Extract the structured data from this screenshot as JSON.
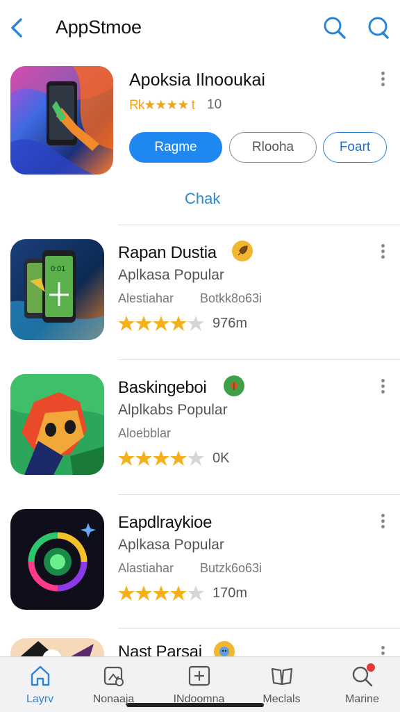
{
  "header": {
    "title": "AppStmoe",
    "back_icon": "chevron-left-icon",
    "search_icon": "search-icon",
    "search2_icon": "search-bubble-icon",
    "accent": "#1e88f0"
  },
  "featured": {
    "title": "Apoksia Ilnooukai",
    "rating_text": "Rk★★★★ t",
    "rating_count": "10",
    "btn_primary": "Ragme",
    "btn_outline": "Rlooha",
    "btn_blue": "Foart",
    "link": "Chak"
  },
  "list": [
    {
      "title": "Rapan Dustia",
      "subtitle": "Aplkasa Popular",
      "meta1": "Alestiahar",
      "meta2": "Botkk8o63i",
      "rating": 4,
      "count": "976m",
      "badge_color": "#f2b631",
      "badge_icon": "rocket-icon"
    },
    {
      "title": "Baskingeboi",
      "subtitle": "Alplkabs Popular",
      "meta1": "Aloebblar",
      "meta2": "",
      "rating": 4,
      "count": "0K",
      "badge_color": "#3fa047",
      "badge_icon": "leaf-icon"
    },
    {
      "title": "Eapdlraykioe",
      "subtitle": "Aplkasa Popular",
      "meta1": "Alastiahar",
      "meta2": "Butzk6o63i",
      "rating": 4,
      "count": "170m",
      "badge_color": "",
      "badge_icon": ""
    },
    {
      "title": "Nast Parsai",
      "subtitle": "",
      "meta1": "",
      "meta2": "",
      "rating": 0,
      "count": "",
      "badge_color": "#f2b631",
      "badge_icon": "face-icon"
    }
  ],
  "nav": [
    {
      "label": "Layrv",
      "icon": "home-icon",
      "active": true
    },
    {
      "label": "Nonaaja",
      "icon": "media-icon",
      "active": false
    },
    {
      "label": "INdoomna",
      "icon": "plus-box-icon",
      "active": false
    },
    {
      "label": "Meclals",
      "icon": "book-icon",
      "active": false
    },
    {
      "label": "Marine",
      "icon": "search-icon",
      "active": false
    }
  ],
  "colors": {
    "star": "#f4b11c",
    "star_empty": "#d6d6d6",
    "notification_dot": "#e53935"
  }
}
